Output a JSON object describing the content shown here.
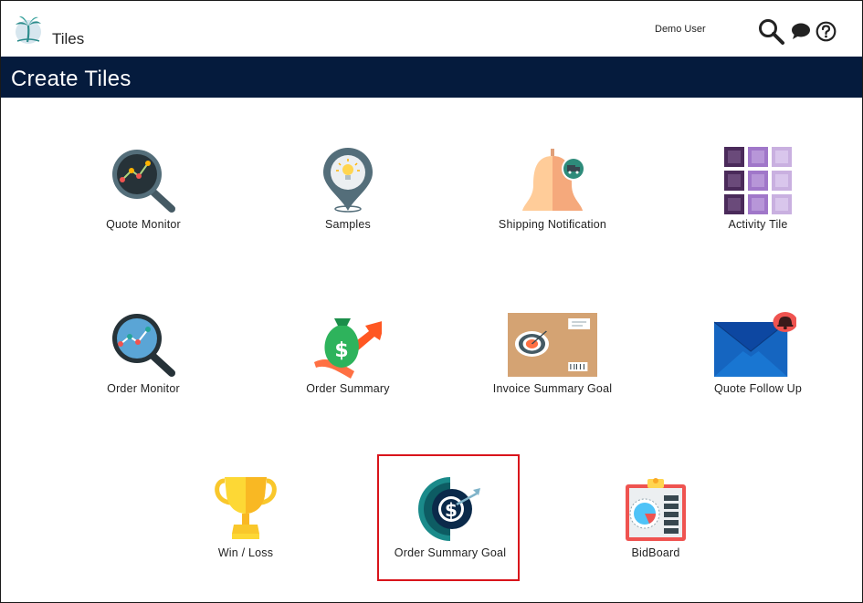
{
  "header": {
    "app_title": "Tiles",
    "user_name": "Demo User",
    "icons": [
      "palm-tree-logo-icon",
      "search-icon",
      "chat-icon",
      "help-icon"
    ]
  },
  "banner": {
    "title": "Create Tiles",
    "color": "#051b3d"
  },
  "tiles": [
    {
      "label": "Quote Monitor",
      "icon": "quote-monitor-icon"
    },
    {
      "label": "Samples",
      "icon": "samples-pin-icon"
    },
    {
      "label": "Shipping Notification",
      "icon": "shipping-bell-icon"
    },
    {
      "label": "Activity Tile",
      "icon": "activity-grid-icon"
    },
    {
      "label": "Order Monitor",
      "icon": "order-monitor-icon"
    },
    {
      "label": "Order Summary",
      "icon": "money-bag-icon"
    },
    {
      "label": "Invoice Summary Goal",
      "icon": "invoice-target-icon"
    },
    {
      "label": "Quote Follow Up",
      "icon": "envelope-alert-icon"
    },
    {
      "label": "Win / Loss",
      "icon": "trophy-icon"
    },
    {
      "label": "Order Summary Goal",
      "icon": "dollar-target-icon",
      "selected": true
    },
    {
      "label": "BidBoard",
      "icon": "clipboard-chart-icon"
    }
  ],
  "colors": {
    "selection_border": "#d9141b",
    "banner": "#051b3d"
  }
}
